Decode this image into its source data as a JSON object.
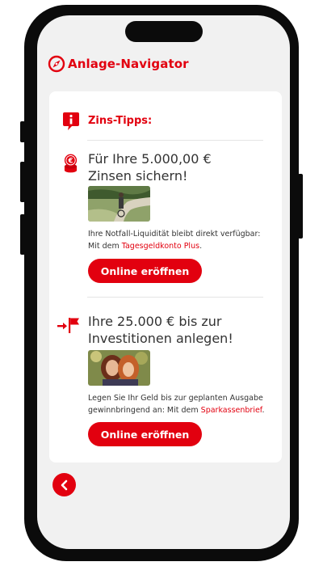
{
  "app": {
    "title": "Anlage-Navigator",
    "accent_color": "#e2000f"
  },
  "tips": {
    "heading": "Zins-Tipps:",
    "items": [
      {
        "icon": "coin-stack-icon",
        "headline_line1": "Für Ihre 5.000,00 €",
        "headline_line2": "Zinsen sichern!",
        "image": "person-cycling-on-path-photo",
        "body_prefix": "Ihre Notfall-Liquidität bleibt direkt verfügbar: Mit dem ",
        "link_text": "Tagesgeldkonto Plus",
        "body_suffix": ".",
        "button_label": "Online eröffnen"
      },
      {
        "icon": "arrow-to-flag-icon",
        "headline_line1": "Ihre 25.000 € bis zur",
        "headline_line2": "Investitionen anlegen!",
        "image": "two-smiling-women-photo",
        "body_prefix": "Legen Sie Ihr Geld bis zur geplanten Ausgabe gewinnbringend an: Mit dem ",
        "link_text": "Sparkassenbrief",
        "body_suffix": ".",
        "button_label": "Online eröffnen"
      }
    ]
  },
  "nav": {
    "back_icon": "chevron-left-icon"
  }
}
